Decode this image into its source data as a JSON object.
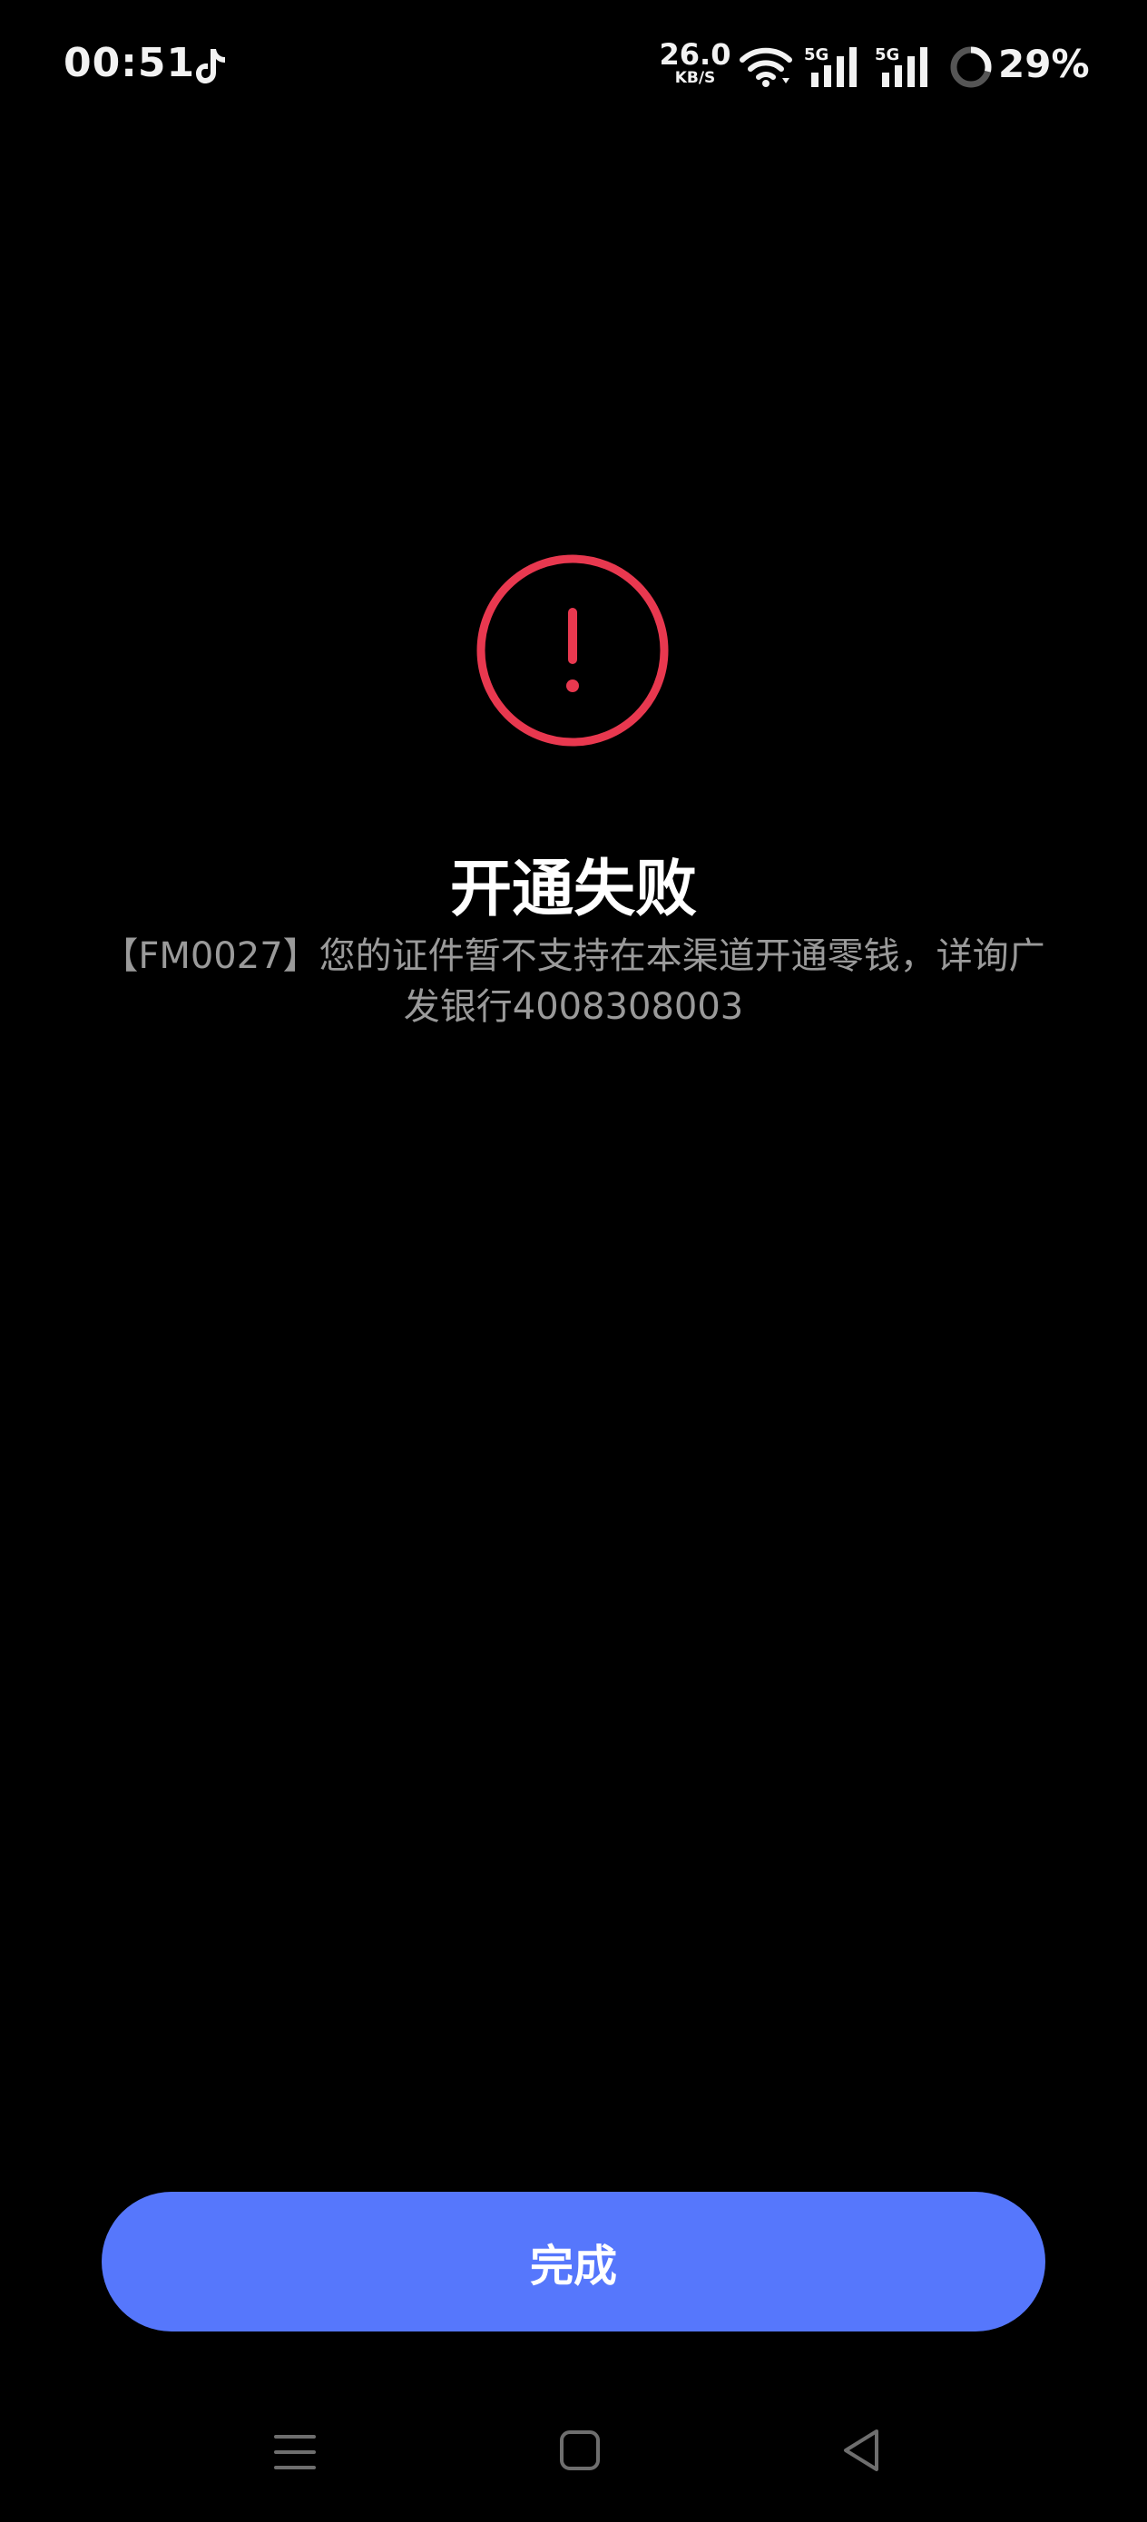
{
  "status_bar": {
    "time": "00:51",
    "app_icon": "tiktok-icon",
    "network_speed_value": "26.0",
    "network_speed_unit": "KB/S",
    "wifi_icon": "wifi-icon",
    "sim1_label": "5G",
    "sim2_label": "5G",
    "battery_percent": "29%",
    "battery_level": 0.29
  },
  "result": {
    "icon": "error-exclamation-circle-icon",
    "icon_color": "#e8384f",
    "title": "开通失败",
    "message": "【FM0027】您的证件暂不支持在本渠道开通零钱，详询广发银行4008308003"
  },
  "actions": {
    "done_label": "完成",
    "done_color": "#5677fc"
  },
  "navigation": {
    "menu_icon": "menu-icon",
    "home_icon": "home-icon",
    "back_icon": "back-icon"
  }
}
